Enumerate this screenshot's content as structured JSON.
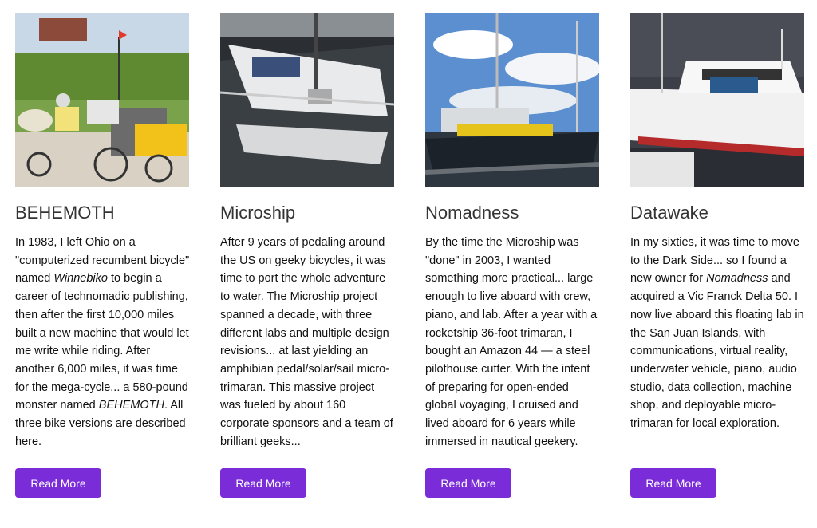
{
  "cards": [
    {
      "title": "BEHEMOTH",
      "text": [
        {
          "t": "In 1983, I left Ohio on a \"computerized recumbent bicycle\" named "
        },
        {
          "t": "Winnebiko",
          "i": true
        },
        {
          "t": " to begin a career of technomadic publishing, then after the first 10,000 miles built a new machine that would let me write while riding. After another 6,000 miles, it was time for the mega-cycle... a 580-pound monster named "
        },
        {
          "t": "BEHEMOTH",
          "i": true
        },
        {
          "t": ". All three bike versions are described here."
        }
      ],
      "button": "Read More"
    },
    {
      "title": "Microship",
      "text": [
        {
          "t": "After 9 years of pedaling around the US on geeky bicycles, it was time to port the whole adventure to water. The Microship project spanned a decade, with three different labs and multiple design revisions... at last yielding an amphibian pedal/solar/sail micro-trimaran. This massive project was fueled by about 160 corporate sponsors and a team of brilliant geeks..."
        }
      ],
      "button": "Read More"
    },
    {
      "title": "Nomadness",
      "text": [
        {
          "t": "By the time the Microship was \"done\" in 2003, I wanted something more practical... large enough to live aboard with crew, piano, and lab. After a year with a rocketship 36-foot trimaran, I bought an Amazon 44 — a steel pilothouse cutter. With the intent of preparing for open-ended global voyaging, I cruised and lived aboard for 6 years while immersed in nautical geekery."
        }
      ],
      "button": "Read More"
    },
    {
      "title": "Datawake",
      "text": [
        {
          "t": "In my sixties, it was time to move to the Dark Side... so I found a new owner for "
        },
        {
          "t": "Nomadness",
          "i": true
        },
        {
          "t": " and acquired a Vic Franck Delta 50. I now live aboard this floating lab in the San Juan Islands, with communications, virtual reality, underwater vehicle, piano, audio studio, data collection, machine shop, and deployable micro-trimaran for local exploration."
        }
      ],
      "button": "Read More"
    }
  ],
  "colors": {
    "button_bg": "#7a2cd9",
    "button_text": "#ffffff",
    "title": "#333333"
  }
}
